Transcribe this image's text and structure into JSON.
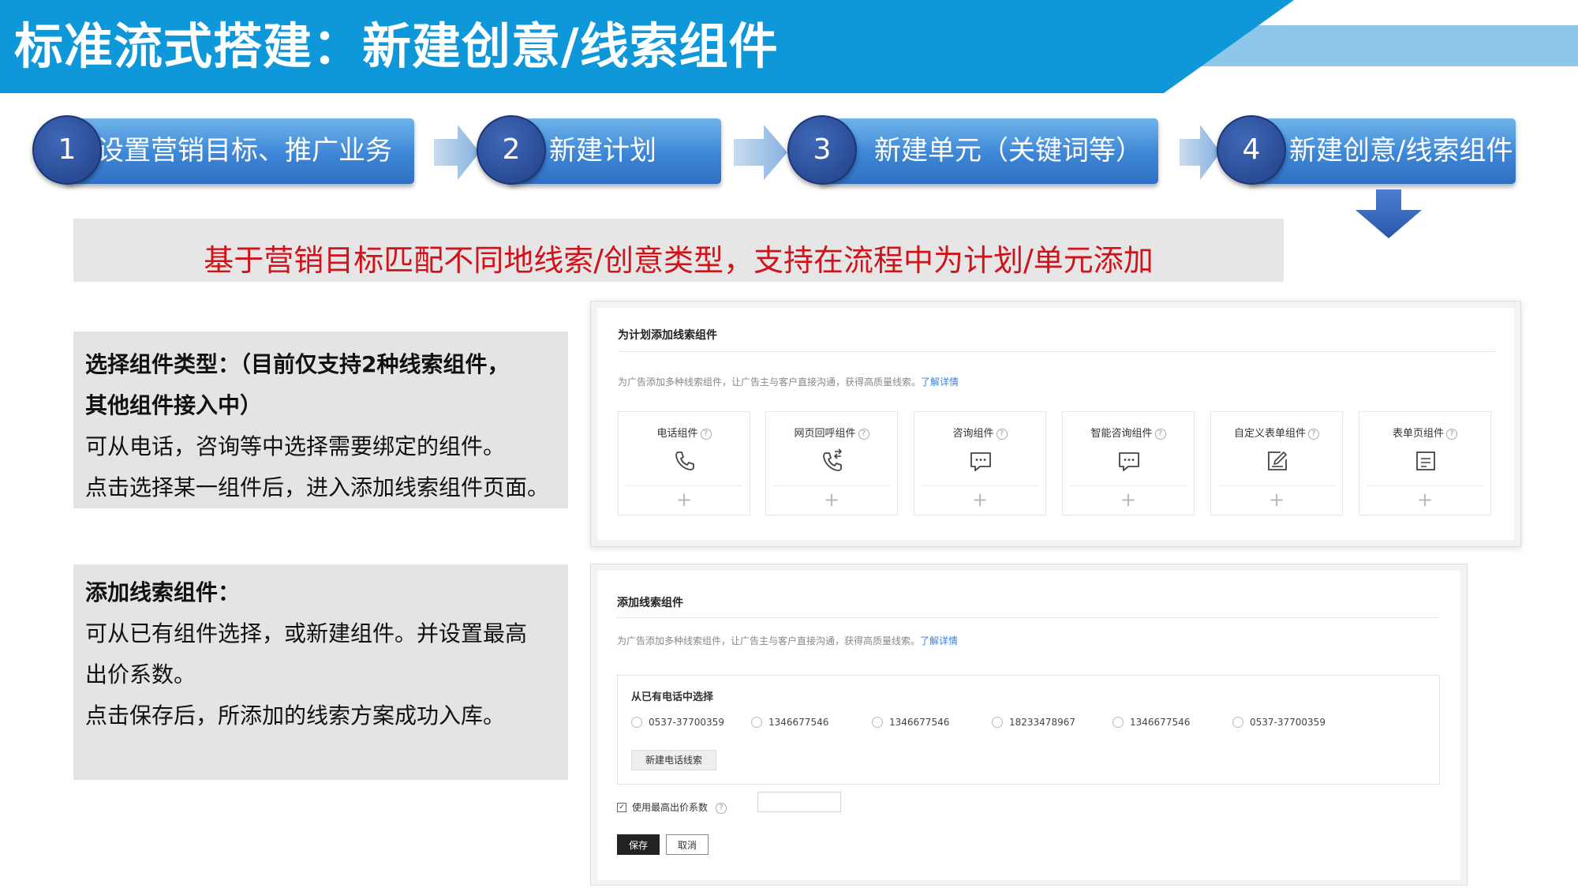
{
  "header": {
    "title": "标准流式搭建：新建创意/线索组件",
    "colors": {
      "primary": "#0e97d9",
      "light": "#8dc8ea"
    }
  },
  "steps": [
    {
      "num": "1",
      "label": "设置营销目标、推广业务"
    },
    {
      "num": "2",
      "label": "新建计划"
    },
    {
      "num": "3",
      "label": "新建单元（关键词等）"
    },
    {
      "num": "4",
      "label": "新建创意/线索组件"
    }
  ],
  "banner": {
    "text": "基于营销目标匹配不同地线索/创意类型，支持在流程中为计划/单元添加",
    "color": "#d0131b"
  },
  "explain_select": {
    "lines": [
      "选择组件类型：（目前仅支持2种线索组件，",
      "其他组件接入中）",
      "可从电话，咨询等中选择需要绑定的组件。",
      "点击选择某一组件后，进入添加线索组件页面。"
    ]
  },
  "explain_add": {
    "lines": [
      "添加线索组件：",
      "可从已有组件选择，或新建组件。并设置最高",
      "出价系数。",
      "点击保存后，所添加的线索方案成功入库。"
    ]
  },
  "panel_select": {
    "title": "为计划添加线索组件",
    "desc": "为广告添加多种线索组件，让广告主与客户直接沟通，获得高质量线索。",
    "link": "了解详情",
    "help_glyph": "?",
    "plus_glyph": "+",
    "cards": [
      {
        "name": "电话组件",
        "icon": "phone-icon"
      },
      {
        "name": "网页回呼组件",
        "icon": "phone-callback-icon"
      },
      {
        "name": "咨询组件",
        "icon": "chat-icon"
      },
      {
        "name": "智能咨询组件",
        "icon": "smart-chat-icon"
      },
      {
        "name": "自定义表单组件",
        "icon": "edit-form-icon"
      },
      {
        "name": "表单页组件",
        "icon": "form-page-icon"
      }
    ]
  },
  "panel_add": {
    "title": "添加线索组件",
    "desc": "为广告添加多种线索组件，让广告主与客户直接沟通，获得高质量线索。",
    "link": "了解详情",
    "choose_title": "从已有电话中选择",
    "phones": [
      "0537-37700359",
      "1346677546",
      "1346677546",
      "18233478967",
      "1346677546",
      "0537-37700359"
    ],
    "new_phone_button": "新建电话线索",
    "bid_label": "使用最高出价系数",
    "bid_value": "",
    "save": "保存",
    "cancel": "取消",
    "help_glyph": "?",
    "check_glyph": "✓"
  }
}
